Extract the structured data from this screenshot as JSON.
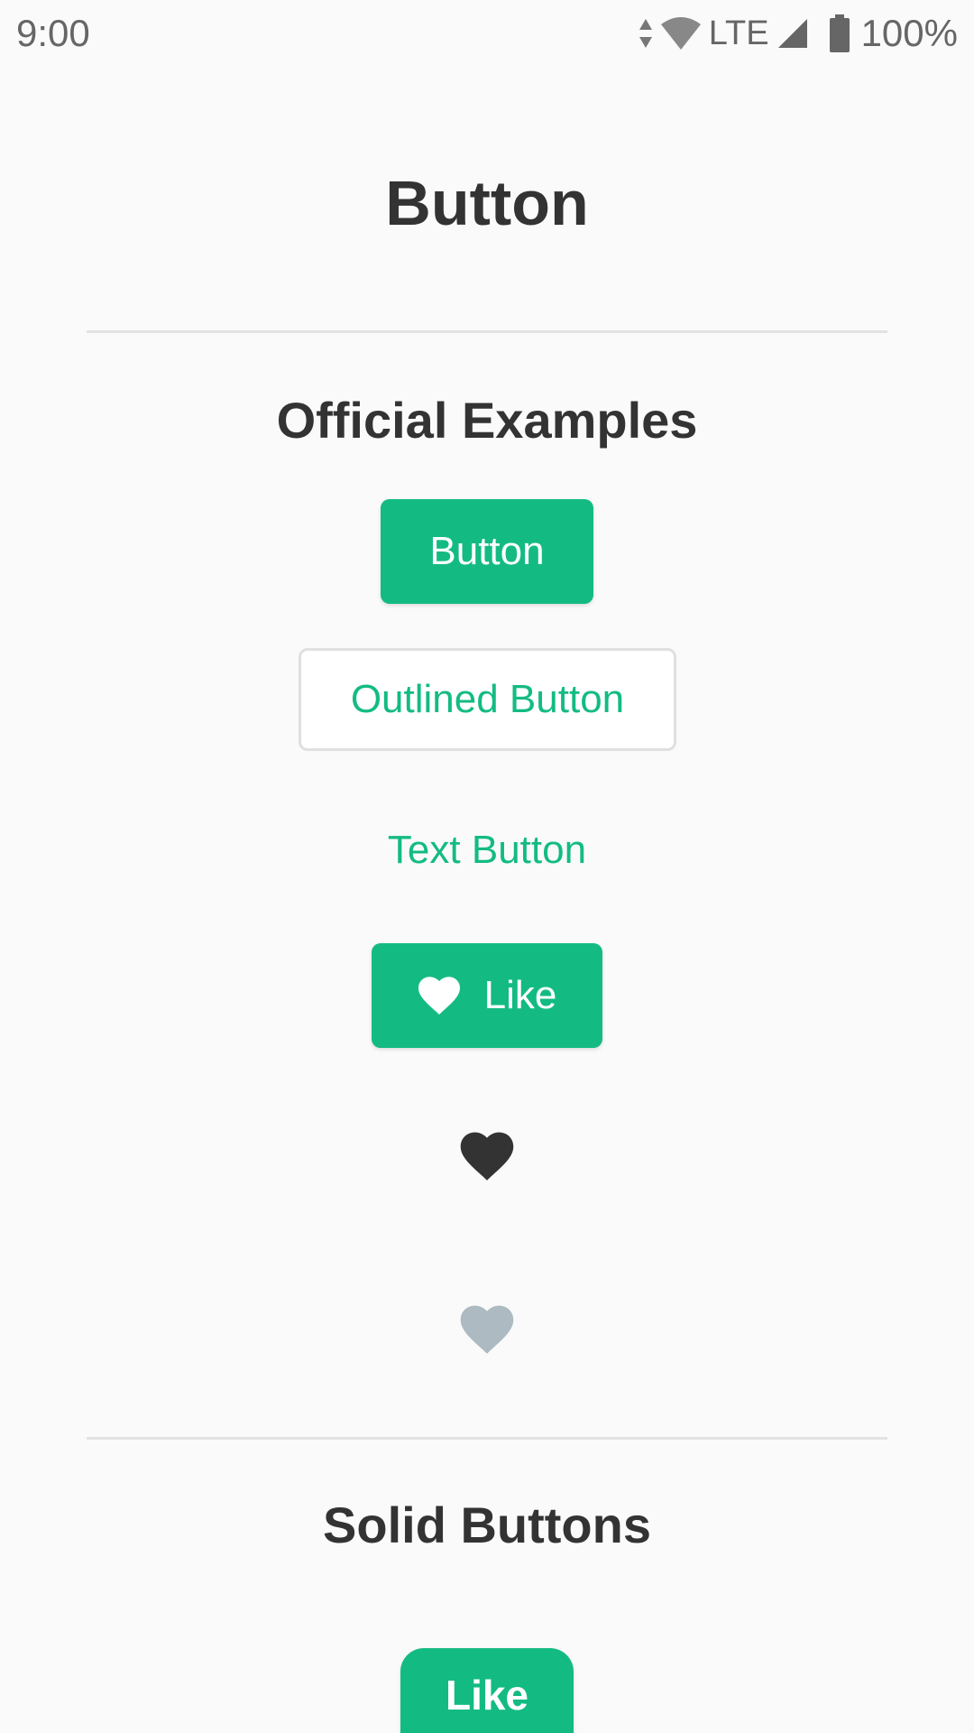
{
  "status_bar": {
    "time": "9:00",
    "network": "LTE",
    "battery": "100%"
  },
  "page": {
    "title": "Button"
  },
  "official_examples": {
    "title": "Official Examples",
    "button_label": "Button",
    "outlined_button_label": "Outlined Button",
    "text_button_label": "Text Button",
    "like_button_label": "Like"
  },
  "solid_buttons": {
    "title": "Solid Buttons",
    "like_button_label": "Like"
  },
  "colors": {
    "accent": "#13bb83",
    "heart_dark": "#333333",
    "heart_disabled": "#adbac2",
    "background": "#fafafa",
    "text": "#333333"
  },
  "icons": {
    "like_button_icon": "heart-icon",
    "standalone_heart_active": "heart-icon",
    "standalone_heart_disabled": "heart-icon"
  }
}
